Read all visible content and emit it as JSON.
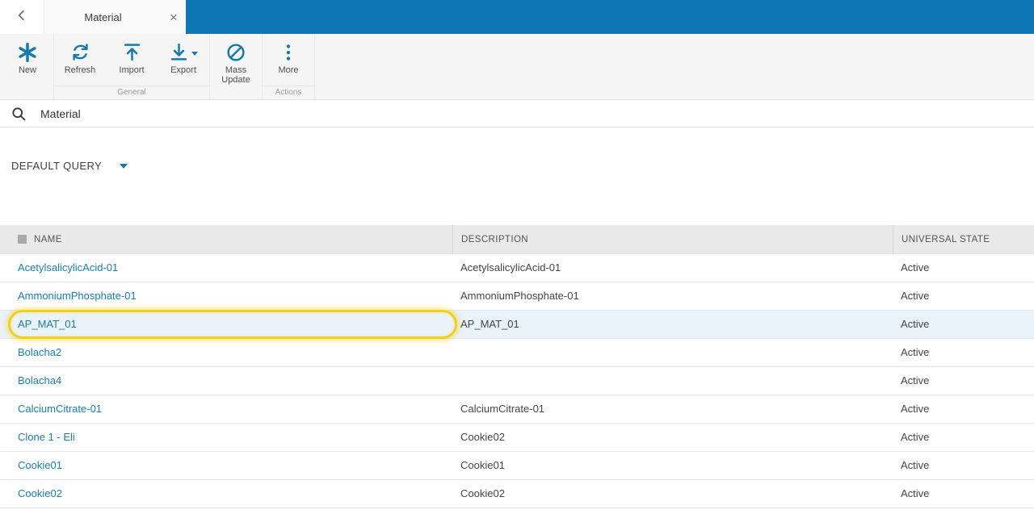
{
  "colors": {
    "accent": "#0e76b4",
    "icon": "#1778ac",
    "link": "#1c7ea8",
    "highlight": "#f2cf1a"
  },
  "tab_bar": {
    "tab_title": "Material",
    "close_label": "×"
  },
  "ribbon": {
    "groups": [
      {
        "label": "",
        "buttons": [
          {
            "label": "New",
            "icon": "asterisk"
          }
        ]
      },
      {
        "label": "General",
        "buttons": [
          {
            "label": "Refresh",
            "icon": "refresh"
          },
          {
            "label": "Import",
            "icon": "import"
          },
          {
            "label": "Export",
            "icon": "export",
            "dropdown": true
          }
        ]
      },
      {
        "label": "",
        "buttons": [
          {
            "label": "Mass Update",
            "icon": "mass-update"
          }
        ]
      },
      {
        "label": "Actions",
        "buttons": [
          {
            "label": "More",
            "icon": "more"
          }
        ]
      }
    ]
  },
  "search": {
    "value": "Material"
  },
  "query": {
    "label": "DEFAULT QUERY"
  },
  "table": {
    "columns": [
      "NAME",
      "DESCRIPTION",
      "UNIVERSAL STATE"
    ],
    "rows": [
      {
        "name": "AcetylsalicylicAcid-01",
        "description": "AcetylsalicylicAcid-01",
        "state": "Active",
        "selected": false,
        "highlighted": false
      },
      {
        "name": "AmmoniumPhosphate-01",
        "description": "AmmoniumPhosphate-01",
        "state": "Active",
        "selected": false,
        "highlighted": false
      },
      {
        "name": "AP_MAT_01",
        "description": "AP_MAT_01",
        "state": "Active",
        "selected": true,
        "highlighted": true
      },
      {
        "name": "Bolacha2",
        "description": "",
        "state": "Active",
        "selected": false,
        "highlighted": false
      },
      {
        "name": "Bolacha4",
        "description": "",
        "state": "Active",
        "selected": false,
        "highlighted": false
      },
      {
        "name": "CalciumCitrate-01",
        "description": "CalciumCitrate-01",
        "state": "Active",
        "selected": false,
        "highlighted": false
      },
      {
        "name": "Clone 1 - Eli",
        "description": "Cookie02",
        "state": "Active",
        "selected": false,
        "highlighted": false
      },
      {
        "name": "Cookie01",
        "description": "Cookie01",
        "state": "Active",
        "selected": false,
        "highlighted": false
      },
      {
        "name": "Cookie02",
        "description": "Cookie02",
        "state": "Active",
        "selected": false,
        "highlighted": false
      }
    ]
  }
}
